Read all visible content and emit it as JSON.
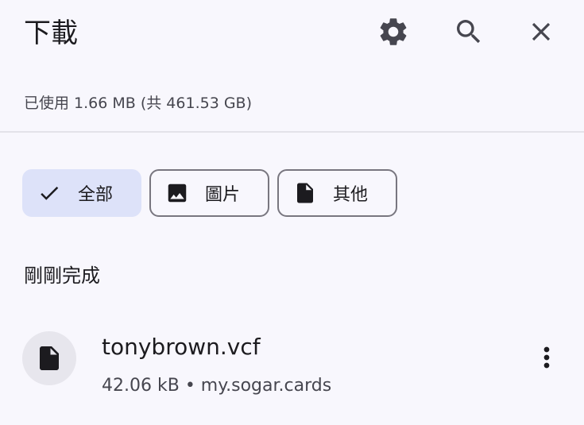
{
  "header": {
    "title": "下載",
    "settings_icon": "gear-icon",
    "search_icon": "search-icon",
    "close_icon": "close-icon"
  },
  "storage": {
    "text": "已使用 1.66 MB (共 461.53 GB)"
  },
  "filters": [
    {
      "label": "全部",
      "icon": "check-icon",
      "selected": true
    },
    {
      "label": "圖片",
      "icon": "image-icon",
      "selected": false
    },
    {
      "label": "其他",
      "icon": "file-icon",
      "selected": false
    }
  ],
  "section": {
    "title": "剛剛完成"
  },
  "downloads": [
    {
      "name": "tonybrown.vcf",
      "size": "42.06 kB",
      "separator": "•",
      "source": "my.sogar.cards",
      "icon": "file-icon"
    }
  ],
  "colors": {
    "background": "#f8f7fd",
    "selected_chip": "#dde2f9",
    "chip_border": "#78767f",
    "text_primary": "#1c1b1f",
    "text_secondary": "#46464f",
    "avatar_bg": "#e7e6ed"
  }
}
